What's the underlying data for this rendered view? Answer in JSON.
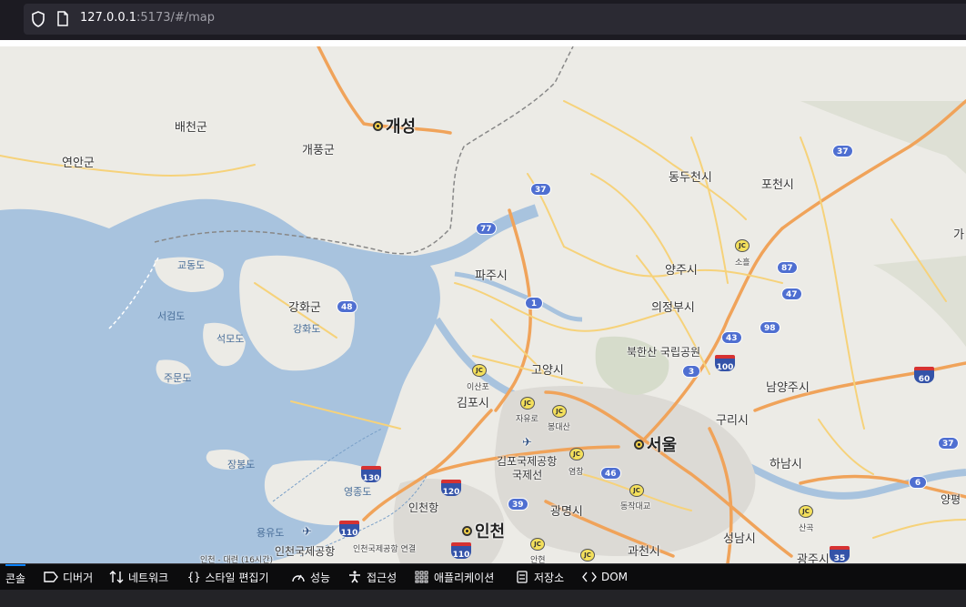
{
  "browser": {
    "url_host": "127.0.0.1",
    "url_rest": ":5173/#/map"
  },
  "map": {
    "cities": [
      {
        "name": "개성",
        "major": true
      },
      {
        "name": "서울",
        "major": true
      },
      {
        "name": "인천",
        "major": true
      }
    ],
    "places": [
      "배천군",
      "개풍군",
      "연안군",
      "동두천시",
      "포천시",
      "양주시",
      "파주시",
      "강화군",
      "의정부시",
      "고양시",
      "김포시",
      "남양주시",
      "구리시",
      "하남시",
      "광명시",
      "과천시",
      "성남시",
      "광주시",
      "교동도",
      "서검도",
      "석모도",
      "주문도",
      "강화도",
      "장봉도",
      "영종도",
      "용유도",
      "북한산 국립공원",
      "김포국제공항",
      "국제선",
      "인천국제공항",
      "인천항",
      "이산포",
      "자유로",
      "봉대산",
      "염창",
      "동작대교",
      "소흘",
      "산곡",
      "안현",
      "가",
      "양평",
      "인천국제공항 연결",
      "인천 - 대련 (16시간)"
    ],
    "badges": [
      "37",
      "77",
      "1",
      "48",
      "3",
      "46",
      "39",
      "6",
      "37",
      "87",
      "47",
      "98",
      "43",
      "37"
    ],
    "expressways": [
      "100",
      "60",
      "130",
      "120",
      "110",
      "110",
      "35"
    ],
    "jc": "JC"
  },
  "devtools": {
    "tabs": [
      {
        "label": "콘솔",
        "icon": "console-icon"
      },
      {
        "label": "디버거",
        "icon": "debugger-icon"
      },
      {
        "label": "네트워크",
        "icon": "network-icon"
      },
      {
        "label": "스타일 편집기",
        "icon": "style-editor-icon"
      },
      {
        "label": "성능",
        "icon": "performance-icon"
      },
      {
        "label": "접근성",
        "icon": "accessibility-icon"
      },
      {
        "label": "애플리케이션",
        "icon": "application-icon"
      },
      {
        "label": "저장소",
        "icon": "storage-icon"
      },
      {
        "label": "DOM",
        "icon": "dom-icon"
      }
    ],
    "active_tab": "콘솔"
  },
  "colors": {
    "water": "#a8c3de",
    "land": "#ecebe6",
    "urban": "#dcdad5",
    "road_major": "#f0a35a",
    "road_minor": "#f6d27a",
    "accent": "#0a84ff"
  }
}
